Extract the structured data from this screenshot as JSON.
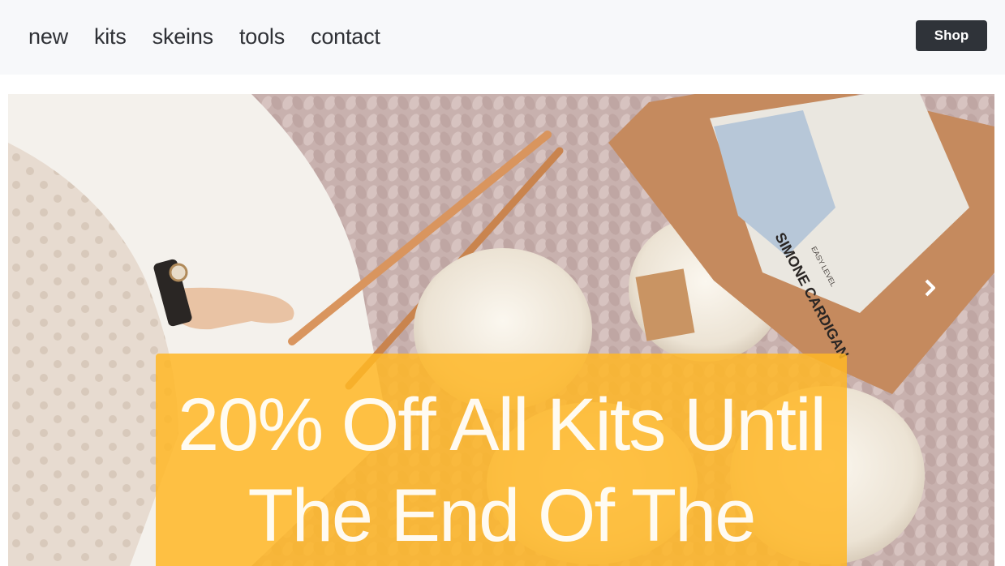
{
  "nav": {
    "links": [
      {
        "label": "new"
      },
      {
        "label": "kits"
      },
      {
        "label": "skeins"
      },
      {
        "label": "tools"
      },
      {
        "label": "contact"
      }
    ],
    "shop_label": "Shop"
  },
  "hero": {
    "caption": "20% Off All Kits Until The End Of The",
    "next_icon": "chevron-right-icon",
    "image_text": {
      "pattern_name": "SIMONE CARDIGAN",
      "level": "EASY LEVEL"
    }
  },
  "colors": {
    "nav_bg": "#f7f8fa",
    "shop_button_bg": "#2f3339",
    "caption_bg": "#ffb726",
    "nav_text": "#2f3136"
  }
}
